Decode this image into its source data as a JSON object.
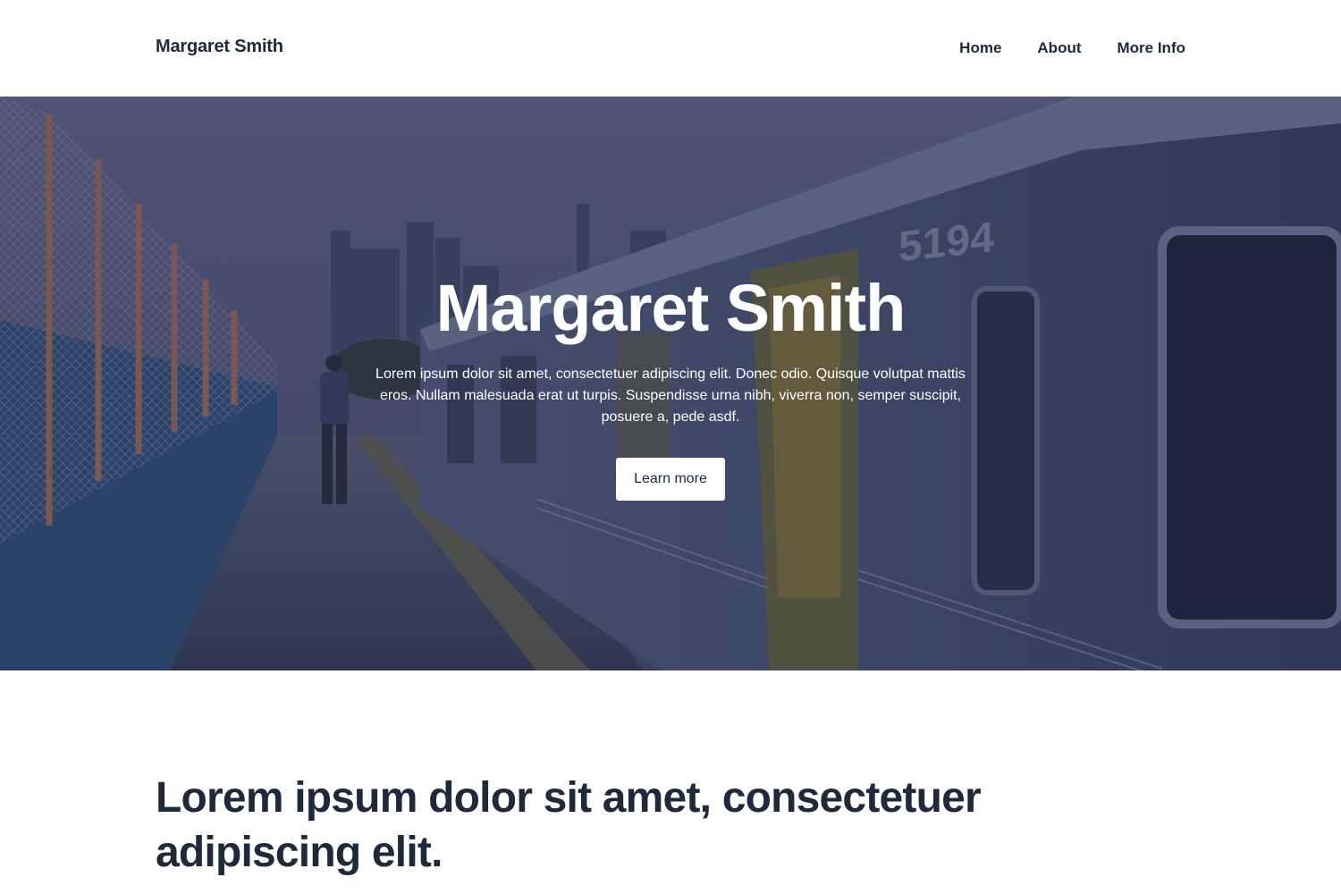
{
  "header": {
    "brand": "Margaret Smith",
    "nav": [
      {
        "label": "Home"
      },
      {
        "label": "About"
      },
      {
        "label": "More Info"
      }
    ]
  },
  "hero": {
    "title": "Margaret Smith",
    "text": "Lorem ipsum dolor sit amet, consectetuer adipiscing elit. Donec odio. Quisque volutpat mattis eros. Nullam malesuada erat ut turpis. Suspendisse urna nibh, viverra non, semper suscipit, posuere a, pede asdf.",
    "button_label": "Learn more",
    "train_number": "5194"
  },
  "section": {
    "heading": "Lorem ipsum dolor sit amet, consectetuer adipiscing elit."
  },
  "colors": {
    "text_dark": "#1e293b",
    "white": "#ffffff",
    "overlay": "#1e2346"
  }
}
